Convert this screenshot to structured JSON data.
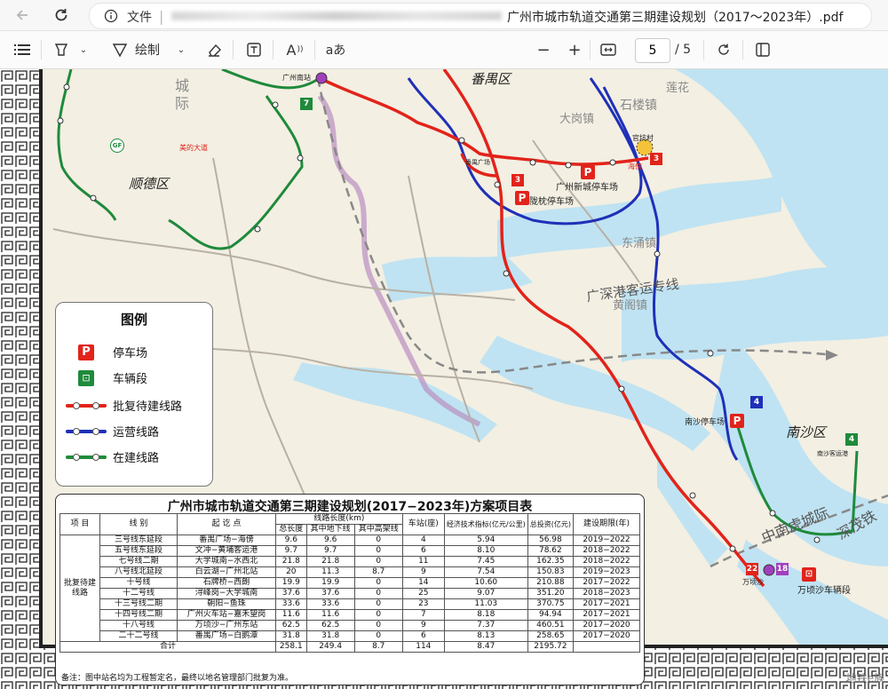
{
  "browser": {
    "back_icon": "back-arrow-icon",
    "reload_icon": "reload-icon",
    "info_icon": "info-icon",
    "file_label": "文件",
    "doc_title": "广州市城市轨道交通第三期建设规划（2017～2023年）.pdf"
  },
  "toolbar": {
    "draw_label": "绘制",
    "read_aloud_label": "A",
    "text_label": "aあ",
    "page_current": "5",
    "page_total": "/ 5",
    "zoom_out": "−",
    "zoom_in": "+"
  },
  "map": {
    "regions": [
      "番禺区",
      "顺德区",
      "南沙区"
    ],
    "city_labels": [
      "城",
      "际",
      "石楼镇",
      "莲花",
      "大岗镇",
      "东涌镇",
      "黄阁镇",
      "广深港客运专线",
      "中南虎城际",
      "深茂铁"
    ],
    "stations": [
      "广州南站",
      "番禺广场",
      "广州新城停车场",
      "陇枕停车场",
      "海傍",
      "官坑村",
      "南沙停车场",
      "南沙客运港",
      "万顷沙",
      "万顷沙车辆段",
      "美的大道"
    ],
    "line_badges": [
      "3",
      "3",
      "7",
      "4",
      "4",
      "22",
      "18",
      "GF"
    ],
    "colors": {
      "approved": "#e2231a",
      "operating": "#1f30b8",
      "construction": "#1f8a3b",
      "water": "#bfe3f2",
      "land": "#f3efe3"
    }
  },
  "legend": {
    "title": "图例",
    "items": [
      {
        "symbol": "parking-icon",
        "label": "停车场"
      },
      {
        "symbol": "depot-icon",
        "label": "车辆段"
      },
      {
        "symbol": "approved-line",
        "label": "批复待建线路"
      },
      {
        "symbol": "operating-line",
        "label": "运营线路"
      },
      {
        "symbol": "construction-line",
        "label": "在建线路"
      }
    ]
  },
  "table": {
    "title": "广州市城市轨道交通第三期建设规划(2017−2023年)方案项目表",
    "headers": {
      "project": "项 目",
      "line": "线 别",
      "endpoints": "起 讫 点",
      "length": "线路长度(km)",
      "total": "总长度",
      "underground": "其中地下线",
      "elevated": "其中高架线",
      "stations": "车站(座)",
      "econ": "经济技术指标(亿元/公里)",
      "invest": "总投资(亿元)",
      "period": "建设期限(年)"
    },
    "group_label": "批复待建线路",
    "rows": [
      [
        "三号线东延段",
        "番禺广场−海傍",
        "9.6",
        "9.6",
        "0",
        "4",
        "5.94",
        "56.98",
        "2019−2022"
      ],
      [
        "五号线东延段",
        "文冲−黄埔客运港",
        "9.7",
        "9.7",
        "0",
        "6",
        "8.10",
        "78.62",
        "2018−2022"
      ],
      [
        "七号线二期",
        "大学城南−水西北",
        "21.8",
        "21.8",
        "0",
        "11",
        "7.45",
        "162.35",
        "2018−2022"
      ],
      [
        "八号线北延段",
        "白云湖−广州北站",
        "20",
        "11.3",
        "8.7",
        "9",
        "7.54",
        "150.83",
        "2019−2023"
      ],
      [
        "十号线",
        "石牌桥−西朗",
        "19.9",
        "19.9",
        "0",
        "14",
        "10.60",
        "210.88",
        "2017−2022"
      ],
      [
        "十二号线",
        "浔峰岗−大学城南",
        "37.6",
        "37.6",
        "0",
        "25",
        "9.07",
        "351.20",
        "2018−2023"
      ],
      [
        "十三号线二期",
        "朝阳−鱼珠",
        "33.6",
        "33.6",
        "0",
        "23",
        "11.03",
        "370.75",
        "2017−2021"
      ],
      [
        "十四号线二期",
        "广州火车站−嘉禾望岗",
        "11.6",
        "11.6",
        "0",
        "7",
        "8.18",
        "94.94",
        "2017−2021"
      ],
      [
        "十八号线",
        "万顷沙−广州东站",
        "62.5",
        "62.5",
        "0",
        "9",
        "7.37",
        "460.51",
        "2017−2020"
      ],
      [
        "二十二号线",
        "番禺广场−白鹅潭",
        "31.8",
        "31.8",
        "0",
        "6",
        "8.13",
        "258.65",
        "2017−2020"
      ]
    ],
    "total_label": "合计",
    "totals": [
      "258.1",
      "249.4",
      "8.7",
      "114",
      "8.47",
      "2195.72"
    ],
    "note": "备注：图中站名均为工程暂定名，最终以地名管理部门批复为准。"
  },
  "watermark": "地铁e族"
}
